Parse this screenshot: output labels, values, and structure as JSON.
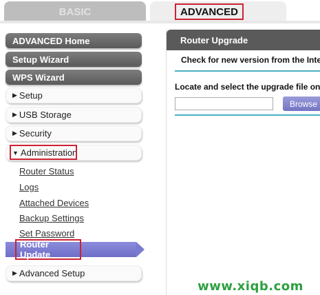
{
  "tabs": {
    "basic": "BASIC",
    "advanced": "ADVANCED"
  },
  "sidebar": {
    "advanced_home": "ADVANCED Home",
    "setup_wizard": "Setup Wizard",
    "wps_wizard": "WPS Wizard",
    "setup": "Setup",
    "usb_storage": "USB Storage",
    "security": "Security",
    "administration": "Administration",
    "admin_items": [
      "Router Status",
      "Logs",
      "Attached Devices",
      "Backup Settings",
      "Set Password"
    ],
    "router_update": "Router Update",
    "advanced_setup": "Advanced Setup",
    "expand_icon": "triangle-right-icon",
    "collapse_icon": "triangle-down-icon"
  },
  "main": {
    "header": "Router Upgrade",
    "check_text": "Check for new version from the Inte",
    "locate_text": "Locate and select the upgrade file on",
    "file_value": "",
    "browse_label": "Browse"
  },
  "watermark": "www.xiqb.com",
  "colors": {
    "highlight_box": "#cc2233",
    "active_item": "#7a7ad0",
    "divider": "#4ab0c0",
    "watermark": "#2da040"
  }
}
